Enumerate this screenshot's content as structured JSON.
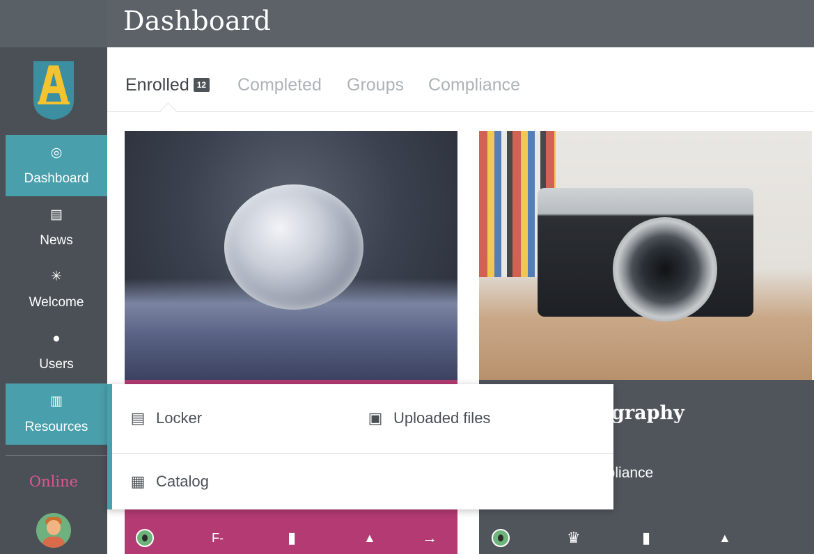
{
  "header": {
    "title": "Dashboard"
  },
  "logo": {
    "letter": "A",
    "shield_color": "#3b8fa0",
    "letter_color": "#f4c430"
  },
  "sidebar": {
    "items": [
      {
        "label": "Dashboard",
        "icon": "dashboard-gauge-icon",
        "glyph": "◎",
        "active": true
      },
      {
        "label": "News",
        "icon": "news-icon",
        "glyph": "▤",
        "active": false
      },
      {
        "label": "Welcome",
        "icon": "welcome-sparkle-icon",
        "glyph": "✳",
        "active": false
      },
      {
        "label": "Users",
        "icon": "user-icon",
        "glyph": "●",
        "active": false
      },
      {
        "label": "Resources",
        "icon": "resources-books-icon",
        "glyph": "▥",
        "active": true
      }
    ],
    "online_label": "Online"
  },
  "tabs": [
    {
      "label": "Enrolled",
      "badge": "12",
      "active": true
    },
    {
      "label": "Completed",
      "active": false
    },
    {
      "label": "Groups",
      "active": false
    },
    {
      "label": "Compliance",
      "active": false
    }
  ],
  "resources_menu": {
    "items": [
      {
        "label": "Locker",
        "icon": "locker-icon",
        "glyph": "▤"
      },
      {
        "label": "Uploaded files",
        "icon": "upload-box-icon",
        "glyph": "▣"
      },
      {
        "label": "Catalog",
        "icon": "catalog-grid-icon",
        "glyph": "▦"
      }
    ]
  },
  "cards": [
    {
      "image": "frozen-bubble-photo",
      "color": "#b33a72",
      "icons": [
        {
          "name": "avatar",
          "glyph": ""
        },
        {
          "name": "grade-text",
          "glyph": "F-"
        },
        {
          "name": "document-icon",
          "glyph": "▮"
        },
        {
          "name": "bell-icon",
          "glyph": "▲"
        },
        {
          "name": "arrow-right-icon",
          "glyph": "→"
        }
      ]
    },
    {
      "image": "camera-photo",
      "title_partial": "ography",
      "subtitle_partial": "npliance",
      "color": "#4f555b",
      "icons": [
        {
          "name": "avatar",
          "glyph": ""
        },
        {
          "name": "trophy-icon",
          "glyph": "♛"
        },
        {
          "name": "document-icon",
          "glyph": "▮"
        },
        {
          "name": "bell-icon",
          "glyph": "▲"
        }
      ]
    }
  ],
  "colors": {
    "accent": "#4a9fac",
    "header": "#5c6268",
    "sidebar": "#4a5056",
    "pink": "#b33a72",
    "online": "#e0568f"
  }
}
